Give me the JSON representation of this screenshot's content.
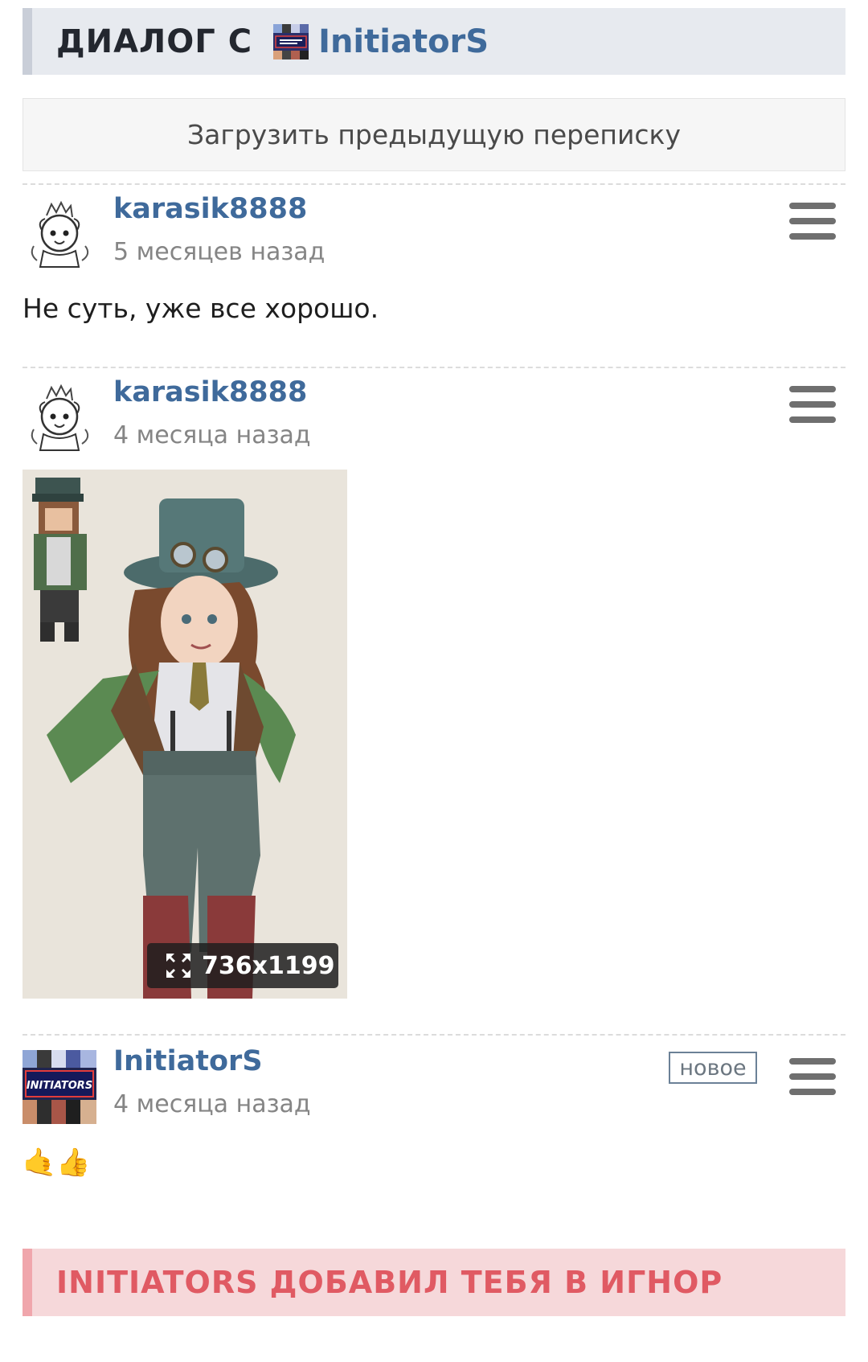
{
  "header": {
    "title": "ДИАЛОГ С",
    "partner_username": "InitiatorS"
  },
  "load_previous_label": "Загрузить предыдущую переписку",
  "messages": [
    {
      "username": "karasik8888",
      "time": "5 месяцев назад",
      "text": "Не суть, уже все хорошо."
    },
    {
      "username": "karasik8888",
      "time": "4 месяца назад",
      "attachment": {
        "type": "image",
        "size_label": "736x1199"
      }
    },
    {
      "username": "InitiatorS",
      "time": "4 месяца назад",
      "badge": "новое",
      "emoji": "🤙👍"
    }
  ],
  "ignore_banner": "INITIATORS ДОБАВИЛ ТЕБЯ В ИГНОР",
  "avatar_logo_text": "INITIATORS",
  "colors": {
    "link_blue": "#3f6a9b",
    "header_bg": "#e7eaef",
    "banner_bg": "#f6d8da",
    "banner_text": "#e05a63"
  }
}
